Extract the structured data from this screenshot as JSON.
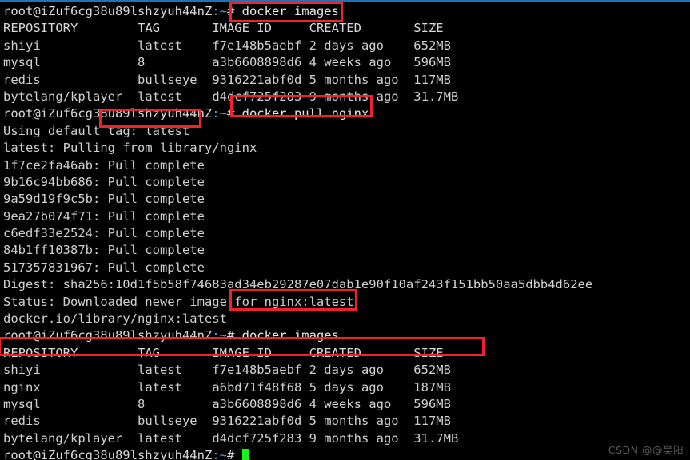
{
  "terminal": {
    "prompt": "root@iZuf6cg38u89lshzyuh44nZ:~#",
    "user_host": "root@iZuf6cg38u89lshzyuh44nZ",
    "path": ":~",
    "hash": "#",
    "cursor": "block-cursor",
    "accent_blue": "#1d72b8",
    "annotation_red": "#f0222a",
    "cursor_green": "#18f218",
    "background": "#000000",
    "foreground": "#d8d8d8"
  },
  "commands": {
    "images_1": "docker images",
    "pull": "docker pull nginx",
    "images_2": "docker images"
  },
  "table_headers": {
    "repository": "REPOSITORY",
    "tag": "TAG",
    "image_id": "IMAGE ID",
    "created": "CREATED",
    "size": "SIZE"
  },
  "table_1": [
    {
      "repository": "shiyi",
      "tag": "latest",
      "image_id": "f7e148b5aebf",
      "created": "2 days ago",
      "size": "652MB"
    },
    {
      "repository": "mysql",
      "tag": "8",
      "image_id": "a3b6608898d6",
      "created": "4 weeks ago",
      "size": "596MB"
    },
    {
      "repository": "redis",
      "tag": "bullseye",
      "image_id": "9316221abf0d",
      "created": "5 months ago",
      "size": "117MB"
    },
    {
      "repository": "bytelang/kplayer",
      "tag": "latest",
      "image_id": "d4dcf725f283",
      "created": "9 months ago",
      "size": "31.7MB"
    }
  ],
  "table_2": [
    {
      "repository": "shiyi",
      "tag": "latest",
      "image_id": "f7e148b5aebf",
      "created": "2 days ago",
      "size": "652MB"
    },
    {
      "repository": "nginx",
      "tag": "latest",
      "image_id": "a6bd71f48f68",
      "created": "5 days ago",
      "size": "187MB"
    },
    {
      "repository": "mysql",
      "tag": "8",
      "image_id": "a3b6608898d6",
      "created": "4 weeks ago",
      "size": "596MB"
    },
    {
      "repository": "redis",
      "tag": "bullseye",
      "image_id": "9316221abf0d",
      "created": "5 months ago",
      "size": "117MB"
    },
    {
      "repository": "bytelang/kplayer",
      "tag": "latest",
      "image_id": "d4dcf725f283",
      "created": "9 months ago",
      "size": "31.7MB"
    }
  ],
  "pull_output": {
    "using_default_prefix": "Using default ",
    "using_default_tag": "tag: latest",
    "pulling_from": "latest: Pulling from library/nginx",
    "layers": [
      "1f7ce2fa46ab: Pull complete",
      "9b16c94bb686: Pull complete",
      "9a59d19f9c5b: Pull complete",
      "9ea27b074f71: Pull complete",
      "c6edf33e2524: Pull complete",
      "84b1ff10387b: Pull complete",
      "517357831967: Pull complete"
    ],
    "digest": "Digest: sha256:10d1f5b58f74683ad34eb29287e07dab1e90f10af243f151bb50aa5dbb4d62ee",
    "status": "Status: Downloaded newer image for nginx:latest",
    "image_ref": "docker.io/library/nginx:latest"
  },
  "watermark": "CSDN @@昊阳"
}
